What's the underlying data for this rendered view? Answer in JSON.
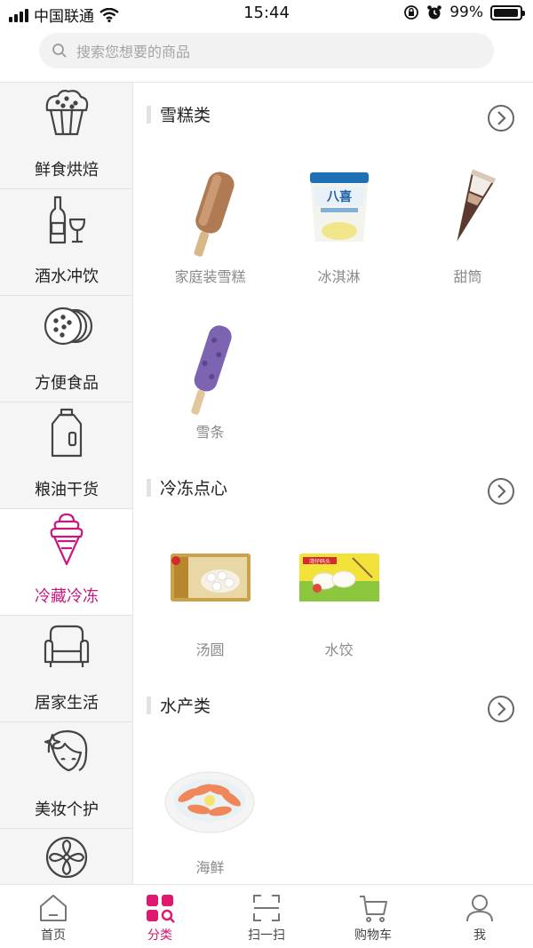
{
  "status_bar": {
    "carrier": "中国联通",
    "time": "15:44",
    "battery": "99%"
  },
  "search": {
    "placeholder": "搜索您想要的商品"
  },
  "sidebar": {
    "items": [
      {
        "label": "鲜食烘焙",
        "icon": "muffin-icon"
      },
      {
        "label": "酒水冲饮",
        "icon": "wine-bottle-icon"
      },
      {
        "label": "方便食品",
        "icon": "crackers-icon"
      },
      {
        "label": "粮油干货",
        "icon": "oil-bottle-icon"
      },
      {
        "label": "冷藏冷冻",
        "icon": "ice-cream-cone-icon",
        "active": true
      },
      {
        "label": "居家生活",
        "icon": "armchair-icon"
      },
      {
        "label": "美妆个护",
        "icon": "face-icon"
      },
      {
        "label": "",
        "icon": "fan-icon"
      }
    ]
  },
  "sections": [
    {
      "title": "雪糕类",
      "items": [
        "家庭装雪糕",
        "冰淇淋",
        "甜筒",
        "雪条"
      ]
    },
    {
      "title": "冷冻点心",
      "items": [
        "汤圆",
        "水饺"
      ]
    },
    {
      "title": "水产类",
      "items": [
        "海鲜"
      ]
    }
  ],
  "product_art": {
    "package_brand_1": "八喜",
    "package_brand_2": "湾仔码头"
  },
  "tabbar": {
    "tabs": [
      {
        "label": "首页",
        "icon": "home-icon"
      },
      {
        "label": "分类",
        "icon": "category-icon",
        "active": true
      },
      {
        "label": "扫一扫",
        "icon": "scan-icon"
      },
      {
        "label": "购物车",
        "icon": "cart-icon"
      },
      {
        "label": "我",
        "icon": "user-icon"
      }
    ]
  },
  "colors": {
    "accent": "#c8177e",
    "tab_accent": "#d0166f",
    "sidebar_bg": "#f5f5f5"
  }
}
